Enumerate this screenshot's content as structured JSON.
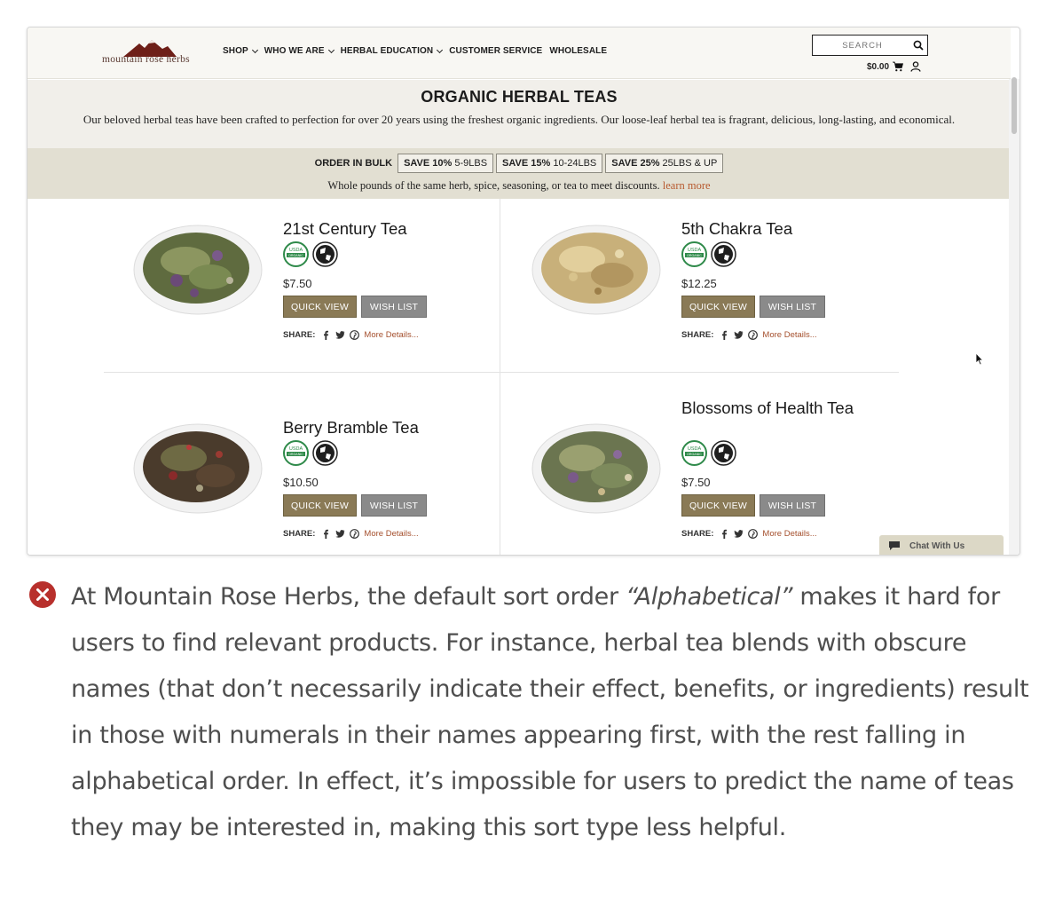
{
  "colors": {
    "accent_olive": "#8a7a56",
    "wishlist_gray": "#8a8a8a",
    "link_rust": "#b75a2f",
    "bulk_bg": "#e2dfd2",
    "intro_bg": "#f1efea",
    "organic_green": "#2f8a4a",
    "error_red": "#b8302c"
  },
  "header": {
    "logo_text": "mountain rose herbs",
    "nav": [
      {
        "label": "SHOP",
        "has_dropdown": true
      },
      {
        "label": "WHO WE ARE",
        "has_dropdown": true
      },
      {
        "label": "HERBAL EDUCATION",
        "has_dropdown": true
      },
      {
        "label": "CUSTOMER SERVICE",
        "has_dropdown": false
      },
      {
        "label": "WHOLESALE",
        "has_dropdown": false
      }
    ],
    "search": {
      "placeholder": "SEARCH",
      "icon": "search-icon"
    },
    "cart_total": "$0.00",
    "cart_icon": "cart-icon",
    "account_icon": "account-icon"
  },
  "intro": {
    "title": "ORGANIC HERBAL TEAS",
    "description": "Our beloved herbal teas have been crafted to perfection for over 20 years using the freshest organic ingredients. Our loose-leaf herbal tea is fragrant, delicious, long-lasting, and economical."
  },
  "bulk": {
    "label": "ORDER IN BULK",
    "tiers": [
      {
        "save": "SAVE 10%",
        "range": "5-9LBS"
      },
      {
        "save": "SAVE 15%",
        "range": "10-24LBS"
      },
      {
        "save": "SAVE 25%",
        "range": "25LBS & UP"
      }
    ],
    "note": "Whole pounds of the same herb, spice, seasoning, or tea to meet discounts.",
    "link": "learn more"
  },
  "products": [
    {
      "name": "21st Century Tea",
      "price": "$7.50",
      "quick_view": "QUICK VIEW",
      "wish_list": "WISH LIST",
      "share_label": "SHARE:",
      "more_details": "More Details...",
      "badges": [
        "usda-organic-icon",
        "fair-trade-globe-icon"
      ]
    },
    {
      "name": "5th Chakra Tea",
      "price": "$12.25",
      "quick_view": "QUICK VIEW",
      "wish_list": "WISH LIST",
      "share_label": "SHARE:",
      "more_details": "More Details...",
      "badges": [
        "usda-organic-icon",
        "fair-trade-globe-icon"
      ]
    },
    {
      "name": "Berry Bramble Tea",
      "price": "$10.50",
      "quick_view": "QUICK VIEW",
      "wish_list": "WISH LIST",
      "share_label": "SHARE:",
      "more_details": "More Details...",
      "badges": [
        "usda-organic-icon",
        "fair-trade-globe-icon"
      ]
    },
    {
      "name": "Blossoms of Health Tea",
      "price": "$7.50",
      "quick_view": "QUICK VIEW",
      "wish_list": "WISH LIST",
      "share_label": "SHARE:",
      "more_details": "More Details...",
      "badges": [
        "usda-organic-icon",
        "fair-trade-globe-icon"
      ]
    }
  ],
  "badge_text": {
    "usda": "USDA",
    "organic": "ORGANIC"
  },
  "chat": {
    "label": "Chat With Us"
  },
  "caption": {
    "before": "At Mountain Rose Herbs, the default sort order ",
    "emphasis": "“Alphabetical”",
    "after": " makes it hard for users to find relevant products. For instance, herbal tea blends with obscure names (that don’t necessarily indicate their effect, benefits, or ingredients) result in those with numerals in their names appearing first, with the rest falling in alphabetical order. In effect, it’s impossible for users to predict the name of teas they may be interested in, making this sort type less helpful."
  }
}
